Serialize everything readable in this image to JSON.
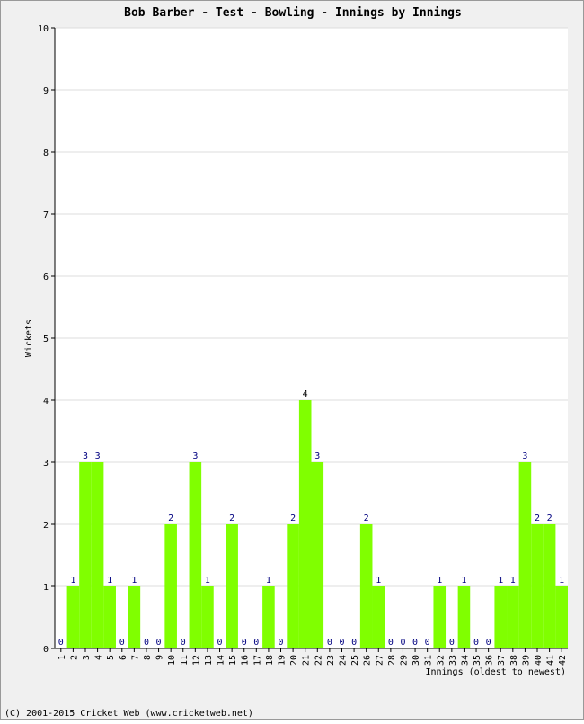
{
  "chart_data": {
    "type": "bar",
    "title": "Bob Barber - Test - Bowling - Innings by Innings",
    "xlabel": "Innings (oldest to newest)",
    "ylabel": "Wickets",
    "ylim": [
      0,
      10
    ],
    "yticks": [
      0,
      1,
      2,
      3,
      4,
      5,
      6,
      7,
      8,
      9,
      10
    ],
    "grid": true,
    "categories": [
      "1",
      "2",
      "3",
      "4",
      "5",
      "6",
      "7",
      "8",
      "9",
      "10",
      "11",
      "12",
      "13",
      "14",
      "15",
      "16",
      "17",
      "18",
      "19",
      "20",
      "21",
      "22",
      "23",
      "24",
      "25",
      "26",
      "27",
      "28",
      "29",
      "30",
      "31",
      "32",
      "33",
      "34",
      "35",
      "36",
      "37",
      "38",
      "39",
      "40",
      "41",
      "42"
    ],
    "values": [
      0,
      1,
      3,
      3,
      1,
      0,
      1,
      0,
      0,
      2,
      0,
      3,
      1,
      0,
      2,
      0,
      0,
      1,
      0,
      2,
      4,
      3,
      0,
      0,
      0,
      2,
      1,
      0,
      0,
      0,
      0,
      1,
      0,
      1,
      0,
      0,
      1,
      1,
      3,
      2,
      2,
      1
    ],
    "colors": {
      "bar": "#80ff00",
      "label": "#000080",
      "max_label": "#000000",
      "grid": "#dddddd",
      "plot_bg": "#ffffff",
      "page_bg": "#f0f0f0"
    }
  },
  "footer": "(C) 2001-2015 Cricket Web (www.cricketweb.net)"
}
